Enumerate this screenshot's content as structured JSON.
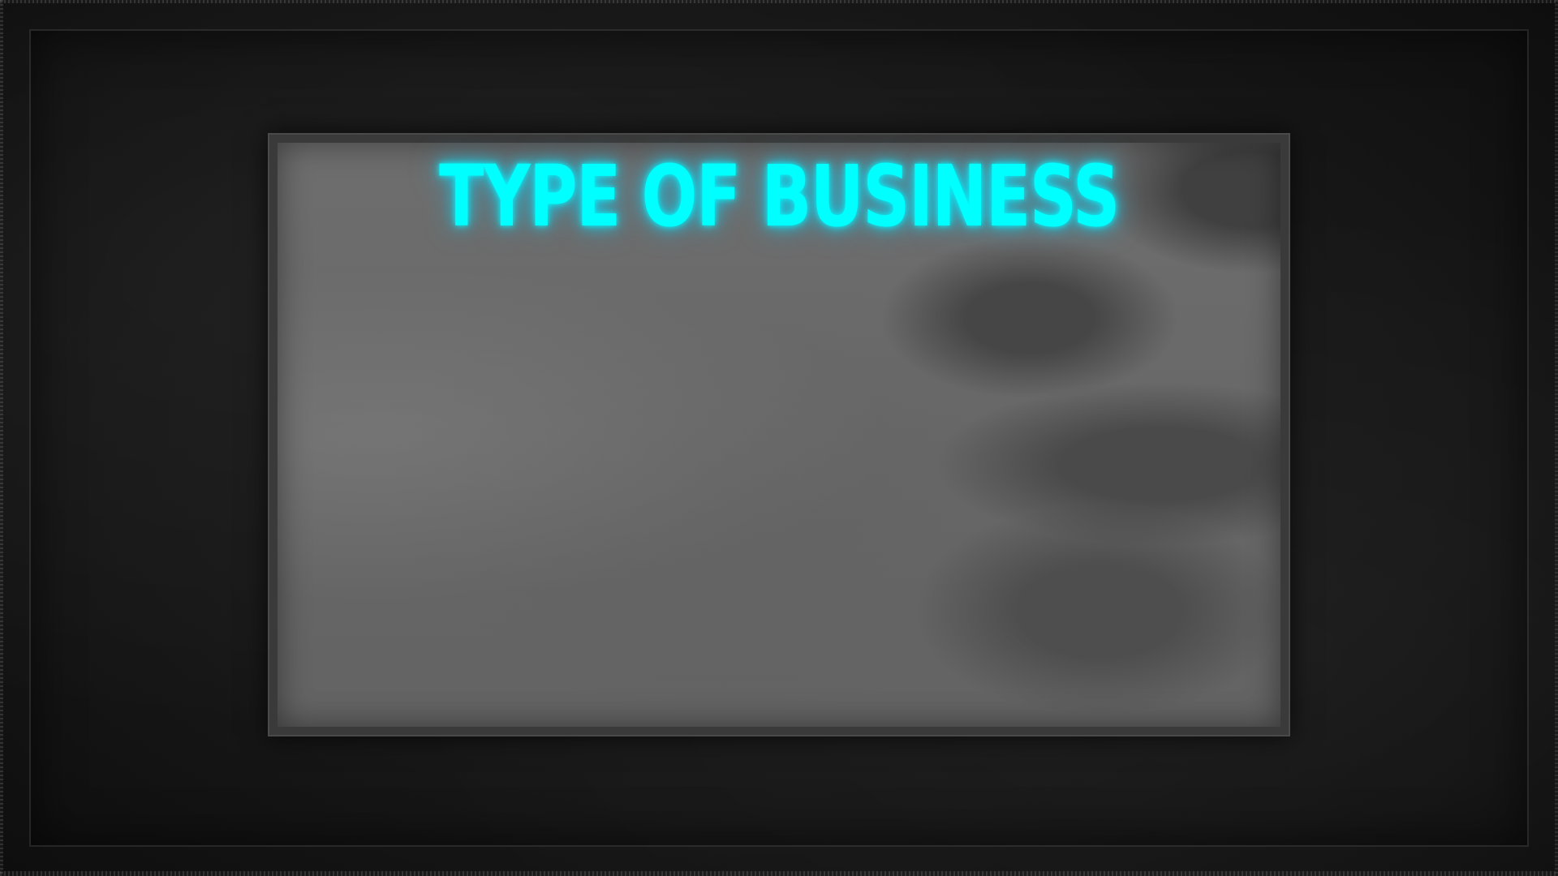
{
  "slide": {
    "title": "TYPE OF BUSINESS"
  },
  "colors": {
    "title_glow": "#00ffff",
    "background": "#171717",
    "panel": "#6a6a6a"
  }
}
